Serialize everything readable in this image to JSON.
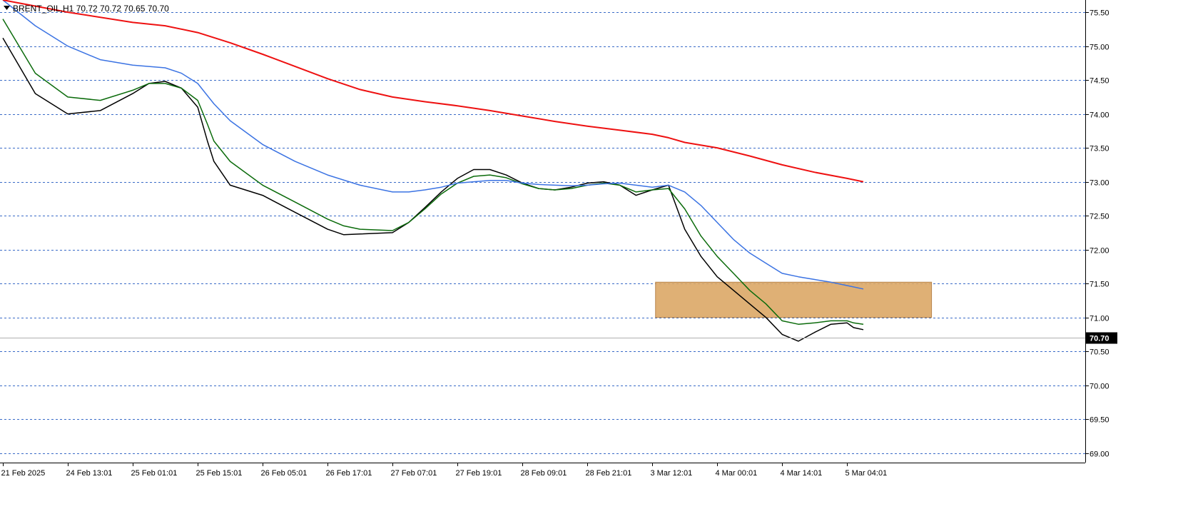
{
  "header": {
    "symbol_line": "BRENT_OIL,H1  70.72 70.72 70.65 70.70"
  },
  "colors": {
    "background": "#ffffff",
    "grid": "#3a6bc7",
    "axis": "#000000",
    "ema_fast": "#000000",
    "ema_mid": "#0b6b0b",
    "ema_slow": "#3b73e3",
    "ema_long": "#ee1111",
    "zone_fill": "#dca766",
    "zone_stroke": "#b8864e",
    "price_tag_bg": "#000000",
    "price_tag_text": "#ffffff",
    "current_line": "#b0b0b0"
  },
  "chart_data": {
    "type": "line",
    "instrument": "BRENT_OIL",
    "timeframe": "H1",
    "ylim": [
      68.86,
      75.68
    ],
    "yticks": [
      "75.50",
      "75.00",
      "74.50",
      "74.00",
      "73.50",
      "73.00",
      "72.50",
      "72.00",
      "71.50",
      "71.00",
      "70.50",
      "70.00",
      "69.50",
      "69.00"
    ],
    "xlim": [
      0,
      274
    ],
    "xticks": [
      {
        "i": 0,
        "label": "21 Feb 2025"
      },
      {
        "i": 20,
        "label": "24 Feb 13:01"
      },
      {
        "i": 40,
        "label": "25 Feb 01:01"
      },
      {
        "i": 60,
        "label": "25 Feb 15:01"
      },
      {
        "i": 80,
        "label": "26 Feb 05:01"
      },
      {
        "i": 100,
        "label": "26 Feb 17:01"
      },
      {
        "i": 120,
        "label": "27 Feb 07:01"
      },
      {
        "i": 140,
        "label": "27 Feb 19:01"
      },
      {
        "i": 160,
        "label": "28 Feb 09:01"
      },
      {
        "i": 180,
        "label": "28 Feb 21:01"
      },
      {
        "i": 200,
        "label": "3 Mar 12:01"
      },
      {
        "i": 220,
        "label": "4 Mar 00:01"
      },
      {
        "i": 240,
        "label": "4 Mar 14:01"
      },
      {
        "i": 260,
        "label": "5 Mar 04:01"
      }
    ],
    "current_price": 70.7,
    "current_price_label": "70.70",
    "zone": {
      "x_start": 201,
      "x_end": 286,
      "y_low": 71.0,
      "y_high": 71.52
    },
    "series": [
      {
        "key": "ema_fast",
        "x": [
          0,
          10,
          20,
          30,
          40,
          45,
          50,
          55,
          60,
          63,
          65,
          70,
          80,
          90,
          100,
          105,
          110,
          120,
          125,
          130,
          135,
          140,
          145,
          150,
          155,
          160,
          165,
          170,
          175,
          180,
          185,
          190,
          195,
          200,
          205,
          210,
          215,
          220,
          225,
          230,
          235,
          240,
          245,
          250,
          255,
          260,
          262,
          265
        ],
        "y": [
          75.12,
          74.3,
          74.0,
          74.05,
          74.3,
          74.45,
          74.48,
          74.38,
          74.1,
          73.6,
          73.3,
          72.95,
          72.8,
          72.55,
          72.3,
          72.22,
          72.23,
          72.25,
          72.4,
          72.62,
          72.85,
          73.05,
          73.18,
          73.18,
          73.1,
          72.98,
          72.9,
          72.88,
          72.92,
          72.98,
          73.0,
          72.95,
          72.8,
          72.88,
          72.95,
          72.3,
          71.9,
          71.6,
          71.4,
          71.2,
          71.0,
          70.75,
          70.65,
          70.78,
          70.9,
          70.92,
          70.85,
          70.82
        ]
      },
      {
        "key": "ema_mid",
        "x": [
          0,
          10,
          20,
          30,
          40,
          45,
          50,
          55,
          60,
          63,
          65,
          70,
          80,
          90,
          100,
          105,
          110,
          120,
          125,
          130,
          135,
          140,
          145,
          150,
          155,
          160,
          165,
          170,
          175,
          180,
          185,
          190,
          195,
          200,
          205,
          210,
          215,
          220,
          225,
          230,
          235,
          240,
          245,
          250,
          255,
          260,
          262,
          265
        ],
        "y": [
          75.4,
          74.6,
          74.25,
          74.2,
          74.35,
          74.45,
          74.45,
          74.38,
          74.2,
          73.85,
          73.6,
          73.3,
          72.95,
          72.7,
          72.45,
          72.35,
          72.3,
          72.28,
          72.4,
          72.6,
          72.82,
          72.98,
          73.08,
          73.1,
          73.06,
          72.97,
          72.9,
          72.88,
          72.9,
          72.95,
          72.98,
          72.95,
          72.85,
          72.88,
          72.9,
          72.6,
          72.2,
          71.9,
          71.65,
          71.4,
          71.2,
          70.95,
          70.9,
          70.92,
          70.95,
          70.95,
          70.92,
          70.9
        ]
      },
      {
        "key": "ema_slow",
        "x": [
          0,
          10,
          20,
          30,
          40,
          50,
          55,
          60,
          65,
          70,
          80,
          90,
          100,
          110,
          120,
          125,
          130,
          135,
          140,
          145,
          150,
          155,
          160,
          165,
          170,
          175,
          180,
          185,
          190,
          195,
          200,
          205,
          210,
          215,
          220,
          225,
          230,
          235,
          240,
          245,
          250,
          255,
          260,
          265
        ],
        "y": [
          75.68,
          75.3,
          75.0,
          74.8,
          74.72,
          74.68,
          74.6,
          74.45,
          74.15,
          73.9,
          73.55,
          73.3,
          73.1,
          72.95,
          72.85,
          72.85,
          72.88,
          72.92,
          72.98,
          73.0,
          73.02,
          73.02,
          72.98,
          72.96,
          72.95,
          72.94,
          72.95,
          72.97,
          72.98,
          72.95,
          72.92,
          72.95,
          72.85,
          72.65,
          72.4,
          72.15,
          71.95,
          71.8,
          71.65,
          71.6,
          71.56,
          71.52,
          71.47,
          71.42
        ]
      },
      {
        "key": "ema_long",
        "x": [
          0,
          20,
          40,
          50,
          60,
          70,
          80,
          90,
          100,
          110,
          120,
          130,
          140,
          150,
          160,
          170,
          180,
          190,
          200,
          205,
          210,
          220,
          230,
          240,
          250,
          260,
          265
        ],
        "y": [
          75.68,
          75.5,
          75.35,
          75.3,
          75.2,
          75.05,
          74.88,
          74.7,
          74.52,
          74.36,
          74.25,
          74.18,
          74.12,
          74.05,
          73.97,
          73.89,
          73.82,
          73.76,
          73.7,
          73.65,
          73.58,
          73.5,
          73.38,
          73.25,
          73.14,
          73.05,
          73.0
        ]
      }
    ]
  }
}
